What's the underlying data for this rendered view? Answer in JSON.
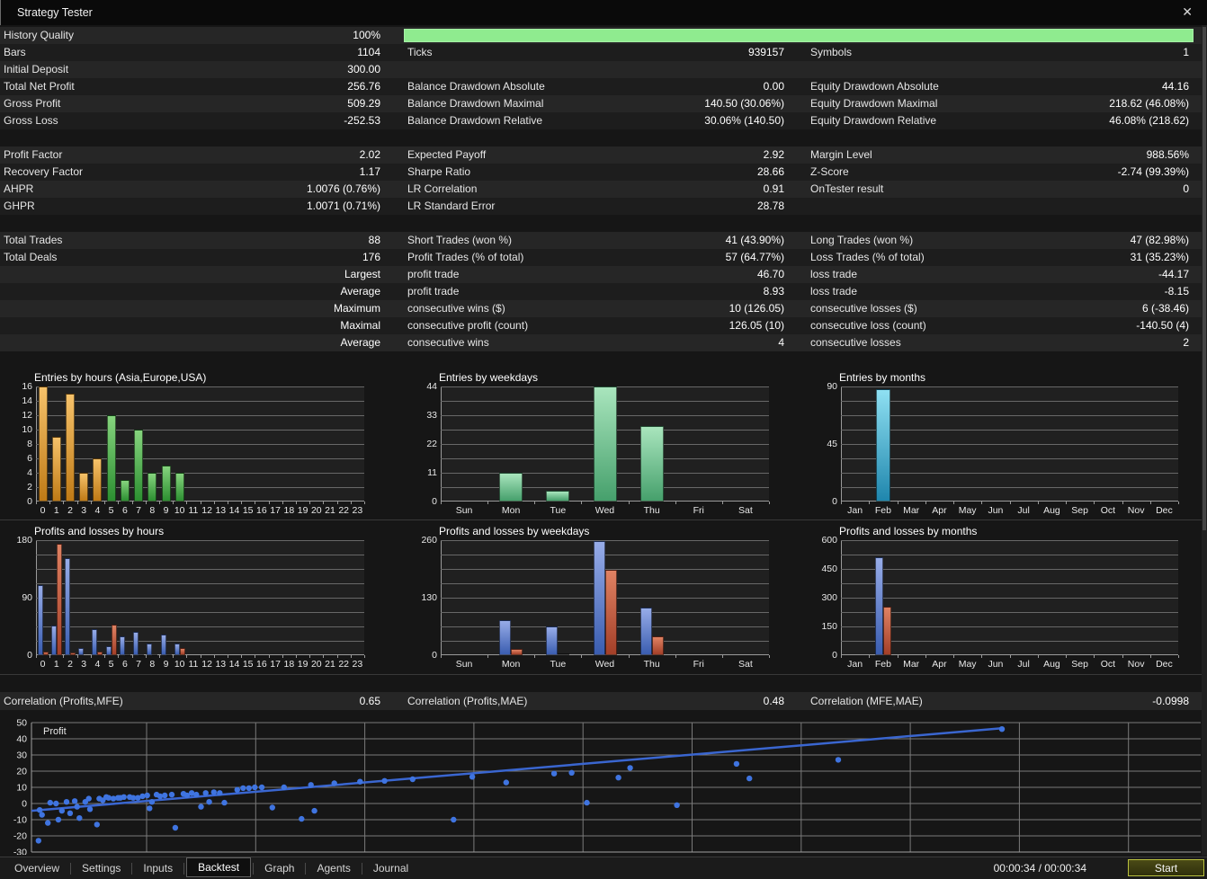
{
  "window": {
    "title": "Strategy Tester",
    "close_glyph": "✕"
  },
  "stats": {
    "rows": [
      {
        "c1l": "History Quality",
        "c1v": "100%",
        "progress": true
      },
      {
        "c1l": "Bars",
        "c1v": "1104",
        "c2l": "Ticks",
        "c2v": "939157",
        "c3l": "Symbols",
        "c3v": "1"
      },
      {
        "c1l": "Initial Deposit",
        "c1v": "300.00",
        "c2l": "",
        "c2v": "",
        "c3l": "",
        "c3v": ""
      },
      {
        "c1l": "Total Net Profit",
        "c1v": "256.76",
        "c2l": "Balance Drawdown Absolute",
        "c2v": "0.00",
        "c3l": "Equity Drawdown Absolute",
        "c3v": "44.16"
      },
      {
        "c1l": "Gross Profit",
        "c1v": "509.29",
        "c2l": "Balance Drawdown Maximal",
        "c2v": "140.50 (30.06%)",
        "c3l": "Equity Drawdown Maximal",
        "c3v": "218.62 (46.08%)"
      },
      {
        "c1l": "Gross Loss",
        "c1v": "-252.53",
        "c2l": "Balance Drawdown Relative",
        "c2v": "30.06% (140.50)",
        "c3l": "Equity Drawdown Relative",
        "c3v": "46.08% (218.62)"
      },
      {
        "gap": true
      },
      {
        "c1l": "Profit Factor",
        "c1v": "2.02",
        "c2l": "Expected Payoff",
        "c2v": "2.92",
        "c3l": "Margin Level",
        "c3v": "988.56%"
      },
      {
        "c1l": "Recovery Factor",
        "c1v": "1.17",
        "c2l": "Sharpe Ratio",
        "c2v": "28.66",
        "c3l": "Z-Score",
        "c3v": "-2.74 (99.39%)"
      },
      {
        "c1l": "AHPR",
        "c1v": "1.0076 (0.76%)",
        "c2l": "LR Correlation",
        "c2v": "0.91",
        "c3l": "OnTester result",
        "c3v": "0"
      },
      {
        "c1l": "GHPR",
        "c1v": "1.0071 (0.71%)",
        "c2l": "LR Standard Error",
        "c2v": "28.78",
        "c3l": "",
        "c3v": ""
      },
      {
        "gap": true
      },
      {
        "c1l": "Total Trades",
        "c1v": "88",
        "c2l": "Short Trades (won %)",
        "c2v": "41 (43.90%)",
        "c3l": "Long Trades (won %)",
        "c3v": "47 (82.98%)"
      },
      {
        "c1l": "Total Deals",
        "c1v": "176",
        "c2l": "Profit Trades (% of total)",
        "c2v": "57 (64.77%)",
        "c3l": "Loss Trades (% of total)",
        "c3v": "31 (35.23%)"
      },
      {
        "c1l": "",
        "c1v": "Largest",
        "c2l": "profit trade",
        "c2v": "46.70",
        "c3l": "loss trade",
        "c3v": "-44.17"
      },
      {
        "c1l": "",
        "c1v": "Average",
        "c2l": "profit trade",
        "c2v": "8.93",
        "c3l": "loss trade",
        "c3v": "-8.15"
      },
      {
        "c1l": "",
        "c1v": "Maximum",
        "c2l": "consecutive wins ($)",
        "c2v": "10 (126.05)",
        "c3l": "consecutive losses ($)",
        "c3v": "6 (-38.46)"
      },
      {
        "c1l": "",
        "c1v": "Maximal",
        "c2l": "consecutive profit (count)",
        "c2v": "126.05 (10)",
        "c3l": "consecutive loss (count)",
        "c3v": "-140.50 (4)"
      },
      {
        "c1l": "",
        "c1v": "Average",
        "c2l": "consecutive wins",
        "c2v": "4",
        "c3l": "consecutive losses",
        "c3v": "2"
      }
    ]
  },
  "correlations": [
    {
      "label": "Correlation (Profits,MFE)",
      "value": "0.65"
    },
    {
      "label": "Correlation (Profits,MAE)",
      "value": "0.48"
    },
    {
      "label": "Correlation (MFE,MAE)",
      "value": "-0.0998"
    }
  ],
  "colors": {
    "progress_green": "#8feb8f",
    "scatter_blue": "#3f74e0",
    "trend_blue": "#3a66d0"
  },
  "chart_data": [
    {
      "type": "bar",
      "title": "Entries by hours (Asia,Europe,USA)",
      "categories": [
        "0",
        "1",
        "2",
        "3",
        "4",
        "5",
        "6",
        "7",
        "8",
        "9",
        "10",
        "11",
        "12",
        "13",
        "14",
        "15",
        "16",
        "17",
        "18",
        "19",
        "20",
        "21",
        "22",
        "23"
      ],
      "ylim": 16,
      "grid_step": 2,
      "yticks": [
        0,
        2,
        4,
        6,
        8,
        10,
        12,
        14,
        16
      ],
      "series": [
        {
          "name": "entries",
          "colors": [
            "#86d47e",
            "#2c8f31"
          ],
          "color_ranges": [
            {
              "to": 4,
              "colors": [
                "#f6c26a",
                "#bf7a16"
              ]
            },
            {
              "to": 23,
              "colors": [
                "#86d47e",
                "#2c8f31"
              ]
            }
          ],
          "values": [
            16,
            9,
            15,
            4,
            6,
            12,
            3,
            10,
            4,
            5,
            4,
            0,
            0,
            0,
            0,
            0,
            0,
            0,
            0,
            0,
            0,
            0,
            0,
            0
          ]
        }
      ]
    },
    {
      "type": "bar",
      "title": "Entries by weekdays",
      "categories": [
        "Sun",
        "Mon",
        "Tue",
        "Wed",
        "Thu",
        "Fri",
        "Sat"
      ],
      "ylim": 44,
      "grid_step": 5.5,
      "yticks": [
        0,
        11,
        22,
        33,
        44
      ],
      "series": [
        {
          "name": "entries",
          "colors": [
            "#a9e5bd",
            "#46a06c"
          ],
          "values": [
            0,
            11,
            4,
            44,
            29,
            0,
            0
          ]
        }
      ]
    },
    {
      "type": "bar",
      "title": "Entries by months",
      "categories": [
        "Jan",
        "Feb",
        "Mar",
        "Apr",
        "May",
        "Jun",
        "Jul",
        "Aug",
        "Sep",
        "Oct",
        "Nov",
        "Dec"
      ],
      "ylim": 90,
      "grid_step": 11.25,
      "yticks": [
        0,
        45,
        90
      ],
      "series": [
        {
          "name": "entries",
          "colors": [
            "#8fe0f2",
            "#1f86ad"
          ],
          "values": [
            0,
            88,
            0,
            0,
            0,
            0,
            0,
            0,
            0,
            0,
            0,
            0
          ]
        }
      ]
    },
    {
      "type": "bar",
      "title": "Profits and losses by hours",
      "categories": [
        "0",
        "1",
        "2",
        "3",
        "4",
        "5",
        "6",
        "7",
        "8",
        "9",
        "10",
        "11",
        "12",
        "13",
        "14",
        "15",
        "16",
        "17",
        "18",
        "19",
        "20",
        "21",
        "22",
        "23"
      ],
      "ylim": 180,
      "grid_step": 22.5,
      "yticks": [
        0,
        90,
        180
      ],
      "series": [
        {
          "name": "profit",
          "colors": [
            "#97ace8",
            "#3a5db0"
          ],
          "values": [
            110,
            47,
            152,
            12,
            41,
            14,
            29,
            36,
            18,
            32,
            19,
            0,
            0,
            0,
            0,
            0,
            0,
            0,
            0,
            0,
            0,
            0,
            0,
            0
          ]
        },
        {
          "name": "loss",
          "colors": [
            "#e08263",
            "#a33f28"
          ],
          "values": [
            6,
            175,
            4,
            0,
            6,
            48,
            1,
            1,
            2,
            2,
            12,
            0,
            0,
            0,
            0,
            0,
            0,
            0,
            0,
            0,
            0,
            0,
            0,
            0
          ]
        }
      ]
    },
    {
      "type": "bar",
      "title": "Profits and losses by weekdays",
      "categories": [
        "Sun",
        "Mon",
        "Tue",
        "Wed",
        "Thu",
        "Fri",
        "Sat"
      ],
      "ylim": 260,
      "grid_step": 32.5,
      "yticks": [
        0,
        130,
        260
      ],
      "series": [
        {
          "name": "profit",
          "colors": [
            "#97ace8",
            "#3a5db0"
          ],
          "values": [
            0,
            80,
            65,
            258,
            107,
            0,
            0
          ]
        },
        {
          "name": "loss",
          "colors": [
            "#e08263",
            "#a33f28"
          ],
          "values": [
            0,
            14,
            4,
            194,
            43,
            0,
            0
          ]
        }
      ]
    },
    {
      "type": "bar",
      "title": "Profits and losses by months",
      "categories": [
        "Jan",
        "Feb",
        "Mar",
        "Apr",
        "May",
        "Jun",
        "Jul",
        "Aug",
        "Sep",
        "Oct",
        "Nov",
        "Dec"
      ],
      "ylim": 600,
      "grid_step": 75,
      "yticks": [
        0,
        150,
        300,
        450,
        600
      ],
      "series": [
        {
          "name": "profit",
          "colors": [
            "#97ace8",
            "#3a5db0"
          ],
          "values": [
            0,
            510,
            0,
            0,
            0,
            0,
            0,
            0,
            0,
            0,
            0,
            0
          ]
        },
        {
          "name": "loss",
          "colors": [
            "#e08263",
            "#a33f28"
          ],
          "values": [
            0,
            253,
            0,
            0,
            0,
            0,
            0,
            0,
            0,
            0,
            0,
            0
          ]
        }
      ]
    },
    {
      "type": "scatter",
      "title": "Profit",
      "ylim": [
        -30,
        50
      ],
      "yticks": [
        50,
        40,
        30,
        20,
        10,
        0,
        -10,
        -20,
        -30
      ],
      "trend": [
        [
          0,
          -4.5
        ],
        [
          83,
          46.5
        ]
      ],
      "points": [
        [
          0.6,
          -23
        ],
        [
          0.7,
          -4
        ],
        [
          0.9,
          -7
        ],
        [
          1.4,
          -12
        ],
        [
          1.6,
          0.5
        ],
        [
          2.1,
          0
        ],
        [
          2.3,
          -10
        ],
        [
          2.6,
          -4.5
        ],
        [
          3,
          1
        ],
        [
          3.3,
          -6
        ],
        [
          3.7,
          1.5
        ],
        [
          3.9,
          -2
        ],
        [
          4.1,
          -9
        ],
        [
          4.6,
          1
        ],
        [
          4.9,
          3
        ],
        [
          5,
          -3.5
        ],
        [
          5.6,
          -13
        ],
        [
          5.8,
          3
        ],
        [
          6.1,
          2
        ],
        [
          6.4,
          4
        ],
        [
          6.6,
          3.5
        ],
        [
          7,
          3
        ],
        [
          7.4,
          3.5
        ],
        [
          7.6,
          3.5
        ],
        [
          7.9,
          4
        ],
        [
          8.4,
          4
        ],
        [
          8.7,
          3.5
        ],
        [
          9.1,
          3.5
        ],
        [
          9.5,
          4.5
        ],
        [
          9.9,
          5
        ],
        [
          10.1,
          -3
        ],
        [
          10.3,
          1
        ],
        [
          10.7,
          5.5
        ],
        [
          11,
          4.5
        ],
        [
          11.4,
          5
        ],
        [
          12,
          5.5
        ],
        [
          12.3,
          -15
        ],
        [
          13,
          6
        ],
        [
          13.3,
          5
        ],
        [
          13.7,
          6.5
        ],
        [
          14.1,
          5.5
        ],
        [
          14.5,
          -2
        ],
        [
          14.9,
          6.5
        ],
        [
          15.2,
          1
        ],
        [
          15.6,
          7
        ],
        [
          16.1,
          6.5
        ],
        [
          16.5,
          0.5
        ],
        [
          17.6,
          8.5
        ],
        [
          18.1,
          9.5
        ],
        [
          18.6,
          9.5
        ],
        [
          19.1,
          10
        ],
        [
          19.7,
          10
        ],
        [
          20.6,
          -2.5
        ],
        [
          21.6,
          10
        ],
        [
          23.1,
          -9.5
        ],
        [
          23.9,
          11.5
        ],
        [
          24.2,
          -4.5
        ],
        [
          25.9,
          12.5
        ],
        [
          28.1,
          13.5
        ],
        [
          30.2,
          14
        ],
        [
          32.6,
          15
        ],
        [
          36.1,
          -10
        ],
        [
          37.7,
          16.5
        ],
        [
          40.6,
          13
        ],
        [
          44.7,
          18.5
        ],
        [
          46.2,
          19
        ],
        [
          47.5,
          0.5
        ],
        [
          50.2,
          16
        ],
        [
          51.2,
          22
        ],
        [
          55.2,
          -1
        ],
        [
          60.3,
          24.5
        ],
        [
          61.4,
          15.5
        ],
        [
          69,
          27
        ],
        [
          83,
          46
        ]
      ]
    }
  ],
  "tabs": {
    "items": [
      "Overview",
      "Settings",
      "Inputs",
      "Backtest",
      "Graph",
      "Agents",
      "Journal"
    ],
    "active": "Backtest"
  },
  "status": {
    "time": "00:00:34 / 00:00:34",
    "start_label": "Start"
  }
}
